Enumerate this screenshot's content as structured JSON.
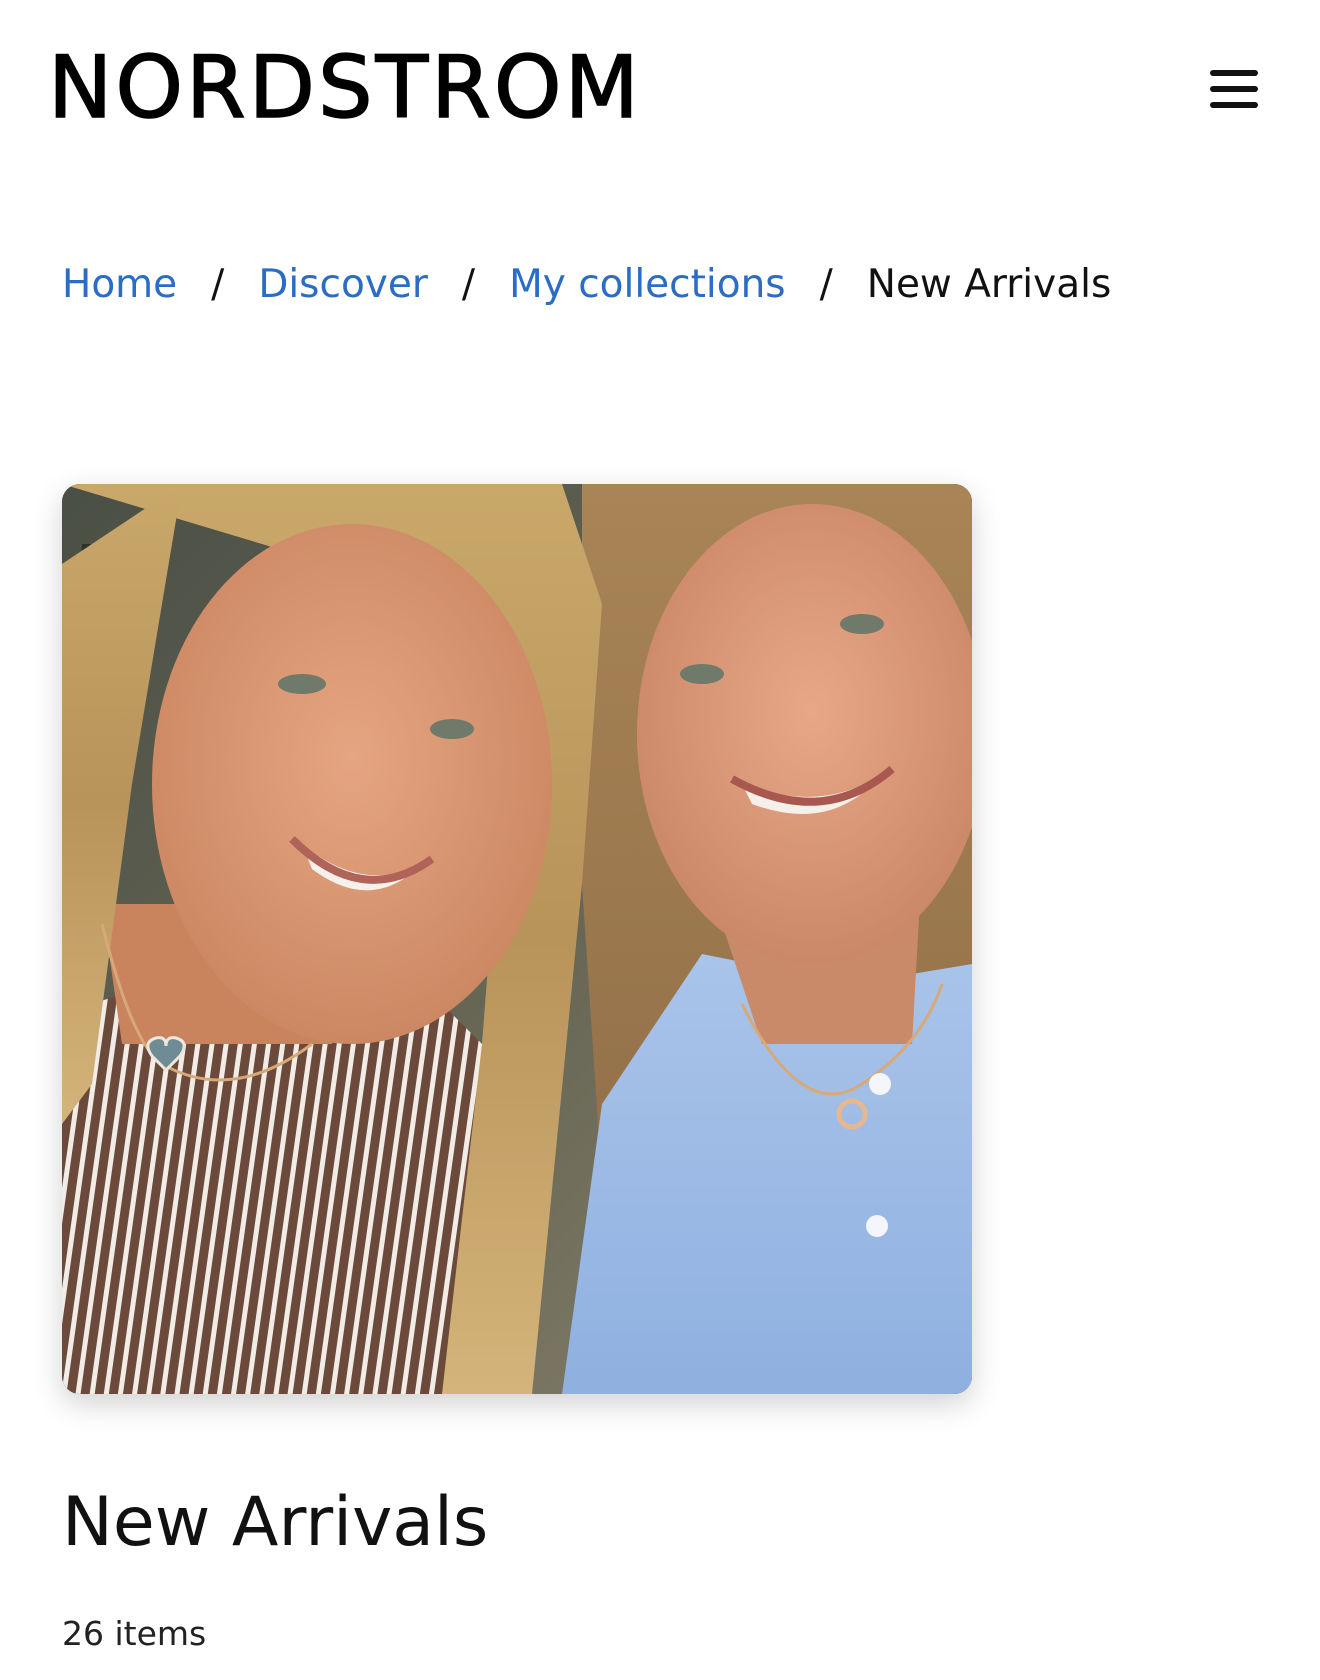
{
  "header": {
    "logo_text": "NORDSTROM",
    "menu_icon": "hamburger-menu-icon"
  },
  "breadcrumb": {
    "items": [
      {
        "label": "Home"
      },
      {
        "label": "Discover"
      },
      {
        "label": "My collections"
      }
    ],
    "separator": "/",
    "current": "New Arrivals"
  },
  "collection": {
    "title": "New Arrivals",
    "item_count": "26 items"
  },
  "colors": {
    "link": "#2b6cc4",
    "text": "#111111",
    "background": "#ffffff"
  }
}
